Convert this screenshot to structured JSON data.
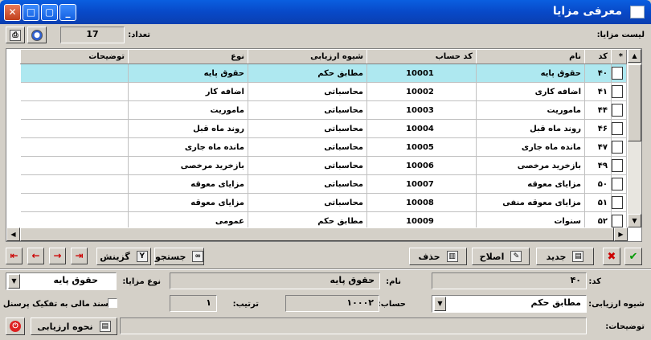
{
  "window": {
    "title": "معرفی مزایا"
  },
  "toolbar": {
    "list_label": "لیست مزایا:",
    "count_label": "تعداد:",
    "count_value": "17"
  },
  "grid": {
    "columns": [
      "*",
      "کد",
      "نام",
      "کد حساب",
      "شیوه ارزیابی",
      "نوع",
      "توضیحات"
    ],
    "rows": [
      {
        "code": "۴۰",
        "name": "حقوق پایه",
        "account": "10001",
        "method": "مطابق حکم",
        "type": "حقوق پایه",
        "desc": ""
      },
      {
        "code": "۴۱",
        "name": "اضافه کاری",
        "account": "10002",
        "method": "محاسباتی",
        "type": "اضافه کار",
        "desc": ""
      },
      {
        "code": "۴۴",
        "name": "ماموریت",
        "account": "10003",
        "method": "محاسباتی",
        "type": "ماموریت",
        "desc": ""
      },
      {
        "code": "۴۶",
        "name": "روند ماه قبل",
        "account": "10004",
        "method": "محاسباتی",
        "type": "روند ماه قبل",
        "desc": ""
      },
      {
        "code": "۴۷",
        "name": "مانده ماه جاری",
        "account": "10005",
        "method": "محاسباتی",
        "type": "مانده ماه جاری",
        "desc": ""
      },
      {
        "code": "۴۹",
        "name": "بازخرید مرخصی",
        "account": "10006",
        "method": "محاسباتی",
        "type": "بازخرید مرخصی",
        "desc": ""
      },
      {
        "code": "۵۰",
        "name": "مزایای معوقه",
        "account": "10007",
        "method": "محاسباتی",
        "type": "مزایای معوقه",
        "desc": ""
      },
      {
        "code": "۵۱",
        "name": "مزایای معوقه منفی",
        "account": "10008",
        "method": "محاسباتی",
        "type": "مزایای معوقه",
        "desc": ""
      },
      {
        "code": "۵۲",
        "name": "سنوات",
        "account": "10009",
        "method": "مطابق حکم",
        "type": "عمومی",
        "desc": ""
      }
    ]
  },
  "actions": {
    "new": "جدید",
    "edit": "اصلاح",
    "delete": "حذف",
    "search": "جستجو",
    "filter": "گزینش"
  },
  "form": {
    "code_label": "کد:",
    "code_value": "۴۰",
    "name_label": "نام:",
    "name_value": "حقوق پایه",
    "type_label": "نوع مزایا:",
    "type_value": "حقوق پایه",
    "method_label": "شیوه ارزیابی:",
    "method_value": "مطابق حکم",
    "account_label": "حساب:",
    "account_value": "۱۰۰۰۲",
    "order_label": "ترتیب:",
    "order_value": "۱",
    "checkbox_label": "سند مالی به تفکیک پرسنل",
    "desc_label": "توضیحات:",
    "desc_value": "",
    "method_button": "نحوه ارزیابی"
  },
  "colors": {
    "title_bar": "#0a5fe0",
    "selected_row": "#aee8f0",
    "window_bg": "#d4d0c8"
  }
}
